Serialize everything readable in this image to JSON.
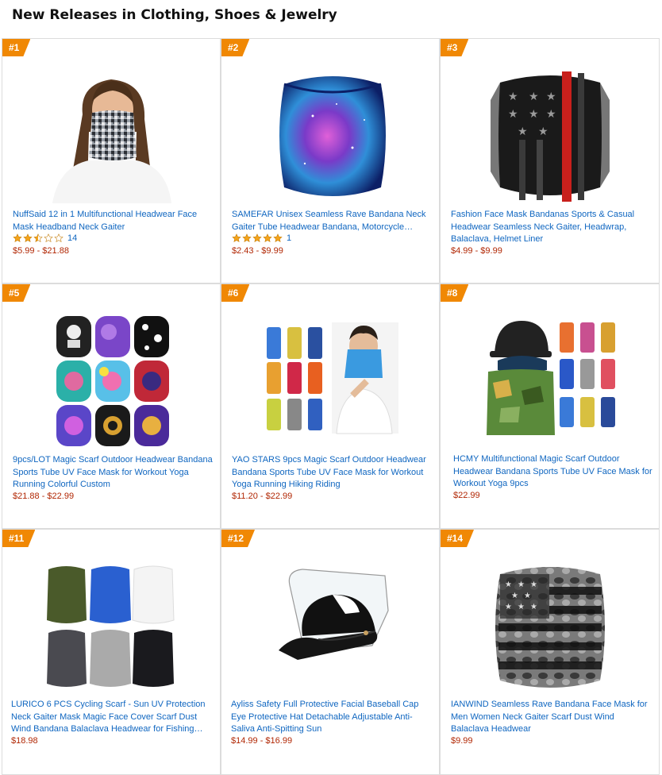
{
  "page_title": "New Releases in Clothing, Shoes & Jewelry",
  "products": [
    {
      "rank": "#1",
      "title": "NuffSaid 12 in 1 Multifunctional Headwear Face Mask Headband Neck Gaiter",
      "rating_count": "14",
      "price": "$5.99 - $21.88",
      "stars": 2.5,
      "image": "woman-pixel-camo-gaiter"
    },
    {
      "rank": "#2",
      "title": "SAMEFAR Unisex Seamless Rave Bandana Neck Gaiter Tube Headwear Bandana, Motorcycle Face…",
      "rating_count": "1",
      "price": "$2.43 - $9.99",
      "stars": 5,
      "image": "galaxy-gaiter"
    },
    {
      "rank": "#3",
      "title": "Fashion Face Mask Bandanas Sports & Casual Headwear Seamless Neck Gaiter, Headwrap, Balaclava, Helmet Liner",
      "price": "$4.99 - $9.99",
      "image": "flag-gaiter"
    },
    {
      "rank": "#5",
      "title": "9pcs/LOT Magic Scarf Outdoor Headwear Bandana Sports Tube UV Face Mask for Workout Yoga Running Colorful Custom",
      "price": "$21.88 - $22.99",
      "image": "nine-pattern-masks"
    },
    {
      "rank": "#6",
      "title": "YAO STARS 9pcs Magic Scarf Outdoor Headwear Bandana Sports Tube UV Face Mask for Workout Yoga Running Hiking Riding",
      "price": "$11.20 - $22.99",
      "image": "nine-scarves-with-model"
    },
    {
      "rank": "#8",
      "title": "HCMY Multifunctional Magic Scarf Outdoor Headwear Bandana Sports Tube UV Face Mask for Workout Yoga 9pcs",
      "price": "$22.99",
      "image": "camo-man-with-scarves"
    },
    {
      "rank": "#11",
      "title": "LURICO 6 PCS Cycling Scarf - Sun UV Protection Neck Gaiter Mask Magic Face Cover Scarf Dust Wind Bandana Balaclava Headwear for Fishing…",
      "price": "$18.98",
      "image": "six-solid-gaiters"
    },
    {
      "rank": "#12",
      "title": "Ayliss Safety Full Protective Facial Baseball Cap Eye Protective Hat Detachable Adjustable Anti-Saliva Anti-Spitting Sun",
      "price": "$14.99 - $16.99",
      "image": "cap-with-face-shield"
    },
    {
      "rank": "#14",
      "title": "IANWIND Seamless Rave Bandana Face Mask for Men Women Neck Gaiter Scarf Dust Wind Balaclava Headwear",
      "price": "$9.99",
      "image": "grey-camo-flag-gaiter"
    }
  ],
  "colors": {
    "link": "#0f66c0",
    "price": "#b12704",
    "badge": "#f08804",
    "star": "#f4a41c"
  }
}
